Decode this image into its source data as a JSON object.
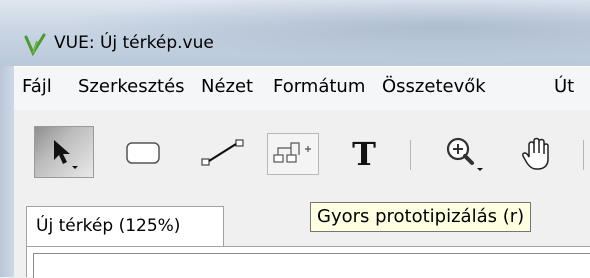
{
  "window": {
    "title": "VUE: Új térkép.vue",
    "app_icon": "vue-logo-icon"
  },
  "menu": {
    "items": [
      "Fájl",
      "Szerkesztés",
      "Nézet",
      "Formátum",
      "Összetevők",
      "Út"
    ]
  },
  "toolbar": {
    "tools": [
      {
        "icon": "selection-arrow-icon",
        "state": "active"
      },
      {
        "icon": "rectangle-node-icon"
      },
      {
        "icon": "link-connector-icon"
      },
      {
        "icon": "rapid-prototype-icon",
        "state": "hover"
      },
      {
        "icon": "text-tool-icon"
      },
      {
        "icon": "zoom-icon"
      },
      {
        "icon": "pan-hand-icon"
      }
    ]
  },
  "tabs": [
    {
      "label": "Új térkép (125%)",
      "active": true
    }
  ],
  "tooltip": {
    "text": "Gyors prototipizálás (r)"
  },
  "colors": {
    "tooltip_bg": "#ffffe1",
    "app_icon_green": "#4f9a2f"
  }
}
